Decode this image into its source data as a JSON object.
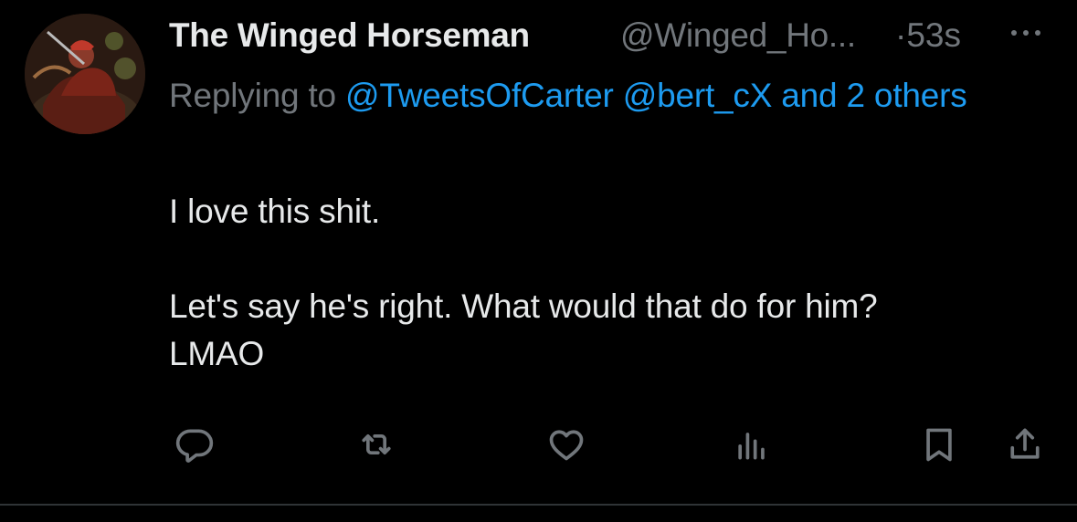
{
  "tweet": {
    "display_name": "The Winged Horseman",
    "handle": "@Winged_Ho...",
    "timestamp": "·53s",
    "replying": {
      "prefix": "Replying to ",
      "mentions": "@TweetsOfCarter @bert_cX and 2 others"
    },
    "text_lines": {
      "line1": "I love this shit.",
      "line2": "Let's say he's right. What would that do for him?",
      "line3": "LMAO"
    }
  },
  "actions": {
    "reply_icon": "reply-icon",
    "retweet_icon": "retweet-icon",
    "like_icon": "heart-icon",
    "views_icon": "views-icon",
    "bookmark_icon": "bookmark-icon",
    "share_icon": "share-icon"
  },
  "colors": {
    "background": "#000000",
    "primary_text": "#e7e9ea",
    "secondary_text": "#71767b",
    "accent": "#1d9bf0",
    "divider": "#2f3336"
  }
}
